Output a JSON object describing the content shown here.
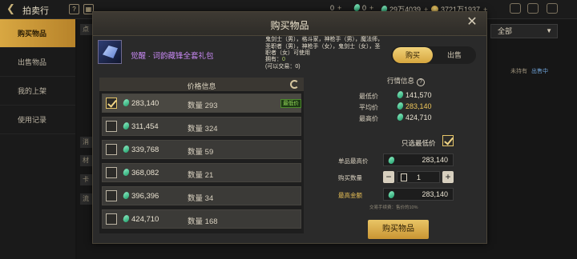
{
  "topbar": {
    "title": "拍卖行",
    "currencies": [
      {
        "value": "0",
        "plus": "+"
      },
      {
        "value": "0",
        "plus": "+"
      },
      {
        "value": "29万4039",
        "plus": "+"
      },
      {
        "value": "3721万1937",
        "plus": "+"
      }
    ]
  },
  "sidebar": {
    "items": [
      {
        "label": "购买物品"
      },
      {
        "label": "出售物品"
      },
      {
        "label": "我的上架"
      },
      {
        "label": "使用记录"
      }
    ]
  },
  "background": {
    "filter_label": "全部",
    "side_tags": [
      "点",
      "消",
      "材",
      "卡",
      "流"
    ],
    "right_notes": [
      "未持有",
      "出售中"
    ]
  },
  "dialog": {
    "title": "购买物品",
    "item": {
      "name": "觉醒 · 词韵藏锋全套礼包",
      "description": "鬼剑士（男），格斗家，神枪手（男），魔法师，圣职者（男），神枪手（女），鬼剑士（女），圣职者（女）可使用",
      "owned_label": "拥有：",
      "owned_value": "0",
      "tradable_label": "(可以交易：",
      "tradable_value": "0)"
    },
    "tabs": {
      "buy": "购买",
      "sell": "出售"
    },
    "price_table": {
      "header": "价格信息",
      "qty_prefix": "数量",
      "lowest_badge": "最低价",
      "rows": [
        {
          "price": "283,140",
          "qty": "293",
          "checked": true,
          "lowest": true
        },
        {
          "price": "311,454",
          "qty": "324",
          "checked": false,
          "lowest": false
        },
        {
          "price": "339,768",
          "qty": "59",
          "checked": false,
          "lowest": false
        },
        {
          "price": "368,082",
          "qty": "21",
          "checked": false,
          "lowest": false
        },
        {
          "price": "396,396",
          "qty": "34",
          "checked": false,
          "lowest": false
        },
        {
          "price": "424,710",
          "qty": "168",
          "checked": false,
          "lowest": false
        }
      ]
    },
    "market": {
      "label": "行情信息",
      "low_label": "最低价",
      "low_value": "141,570",
      "avg_label": "平均价",
      "avg_value": "283,140",
      "high_label": "最高价",
      "high_value": "424,710"
    },
    "form": {
      "only_lowest_label": "只选最低价",
      "unit_max_label": "单品最高价",
      "unit_max_value": "283,140",
      "qty_label": "购买数量",
      "qty_value": "1",
      "total_label": "最高金额",
      "total_value": "283,140",
      "fee_note": "交易手续费：售价的10%",
      "buy_button": "购买物品"
    }
  },
  "colors": {
    "accent": "#d6a63f",
    "item_rarity": "#c889f4",
    "lowest_badge": "#9ae05d"
  }
}
